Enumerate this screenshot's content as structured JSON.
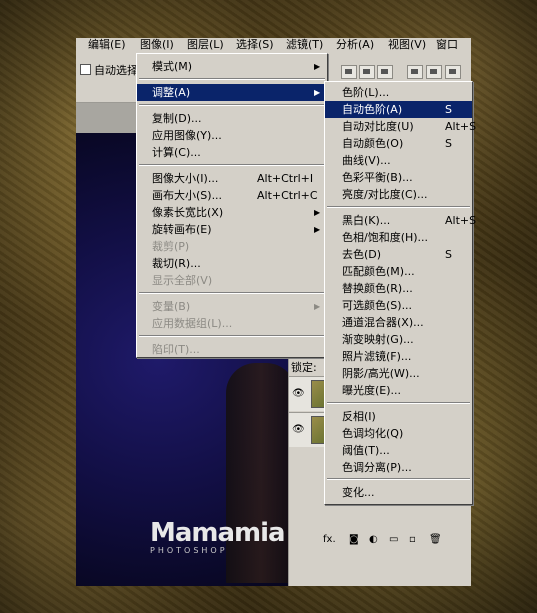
{
  "menubar": {
    "items": [
      "编辑(E)",
      "图像(I)",
      "图层(L)",
      "选择(S)",
      "滤镜(T)",
      "分析(A)",
      "视图(V)",
      "窗口"
    ]
  },
  "options": {
    "auto_select": "自动选择"
  },
  "image_menu": {
    "items": [
      {
        "label": "模式(M)",
        "shortcut": "",
        "submenu": true,
        "state": "normal"
      },
      {
        "label": "调整(A)",
        "shortcut": "",
        "submenu": true,
        "state": "highlighted"
      },
      {
        "label": "复制(D)...",
        "shortcut": "",
        "submenu": false,
        "state": "normal"
      },
      {
        "label": "应用图像(Y)...",
        "shortcut": "",
        "submenu": false,
        "state": "normal"
      },
      {
        "label": "计算(C)...",
        "shortcut": "",
        "submenu": false,
        "state": "normal"
      },
      {
        "label": "图像大小(I)...",
        "shortcut": "Alt+Ctrl+I",
        "submenu": false,
        "state": "normal"
      },
      {
        "label": "画布大小(S)...",
        "shortcut": "Alt+Ctrl+C",
        "submenu": false,
        "state": "normal"
      },
      {
        "label": "像素长宽比(X)",
        "shortcut": "",
        "submenu": true,
        "state": "normal"
      },
      {
        "label": "旋转画布(E)",
        "shortcut": "",
        "submenu": true,
        "state": "normal"
      },
      {
        "label": "裁剪(P)",
        "shortcut": "",
        "submenu": false,
        "state": "disabled"
      },
      {
        "label": "裁切(R)...",
        "shortcut": "",
        "submenu": false,
        "state": "normal"
      },
      {
        "label": "显示全部(V)",
        "shortcut": "",
        "submenu": false,
        "state": "disabled"
      },
      {
        "label": "变量(B)",
        "shortcut": "",
        "submenu": true,
        "state": "disabled"
      },
      {
        "label": "应用数据组(L)...",
        "shortcut": "",
        "submenu": false,
        "state": "disabled"
      },
      {
        "label": "陷印(T)...",
        "shortcut": "",
        "submenu": false,
        "state": "disabled"
      }
    ]
  },
  "adjust_menu": {
    "items": [
      {
        "label": "色阶(L)...",
        "shortcut": "",
        "state": "normal"
      },
      {
        "label": "自动色阶(A)",
        "shortcut": "S",
        "state": "highlighted"
      },
      {
        "label": "自动对比度(U)",
        "shortcut": "Alt+S",
        "state": "normal"
      },
      {
        "label": "自动颜色(O)",
        "shortcut": "S",
        "state": "normal"
      },
      {
        "label": "曲线(V)...",
        "shortcut": "",
        "state": "normal"
      },
      {
        "label": "色彩平衡(B)...",
        "shortcut": "",
        "state": "normal"
      },
      {
        "label": "亮度/对比度(C)...",
        "shortcut": "",
        "state": "normal"
      },
      {
        "label": "黑白(K)...",
        "shortcut": "Alt+S",
        "state": "normal"
      },
      {
        "label": "色相/饱和度(H)...",
        "shortcut": "",
        "state": "normal"
      },
      {
        "label": "去色(D)",
        "shortcut": "S",
        "state": "normal"
      },
      {
        "label": "匹配颜色(M)...",
        "shortcut": "",
        "state": "normal"
      },
      {
        "label": "替换颜色(R)...",
        "shortcut": "",
        "state": "normal"
      },
      {
        "label": "可选颜色(S)...",
        "shortcut": "",
        "state": "normal"
      },
      {
        "label": "通道混合器(X)...",
        "shortcut": "",
        "state": "normal"
      },
      {
        "label": "渐变映射(G)...",
        "shortcut": "",
        "state": "normal"
      },
      {
        "label": "照片滤镜(F)...",
        "shortcut": "",
        "state": "normal"
      },
      {
        "label": "阴影/高光(W)...",
        "shortcut": "",
        "state": "normal"
      },
      {
        "label": "曝光度(E)...",
        "shortcut": "",
        "state": "normal"
      },
      {
        "label": "反相(I)",
        "shortcut": "",
        "state": "normal"
      },
      {
        "label": "色调均化(Q)",
        "shortcut": "",
        "state": "normal"
      },
      {
        "label": "阈值(T)...",
        "shortcut": "",
        "state": "normal"
      },
      {
        "label": "色调分离(P)...",
        "shortcut": "",
        "state": "normal"
      },
      {
        "label": "变化...",
        "shortcut": "",
        "state": "normal"
      }
    ]
  },
  "layers_panel": {
    "lock_label": "锁定:",
    "footer_label": "fx."
  },
  "watermark": {
    "main": "Mamamia",
    "sub": "PHOTOSHOP"
  },
  "colors": {
    "menu_bg": "#d4d0c8",
    "highlight": "#0a246a",
    "disabled": "#8c8a84"
  }
}
